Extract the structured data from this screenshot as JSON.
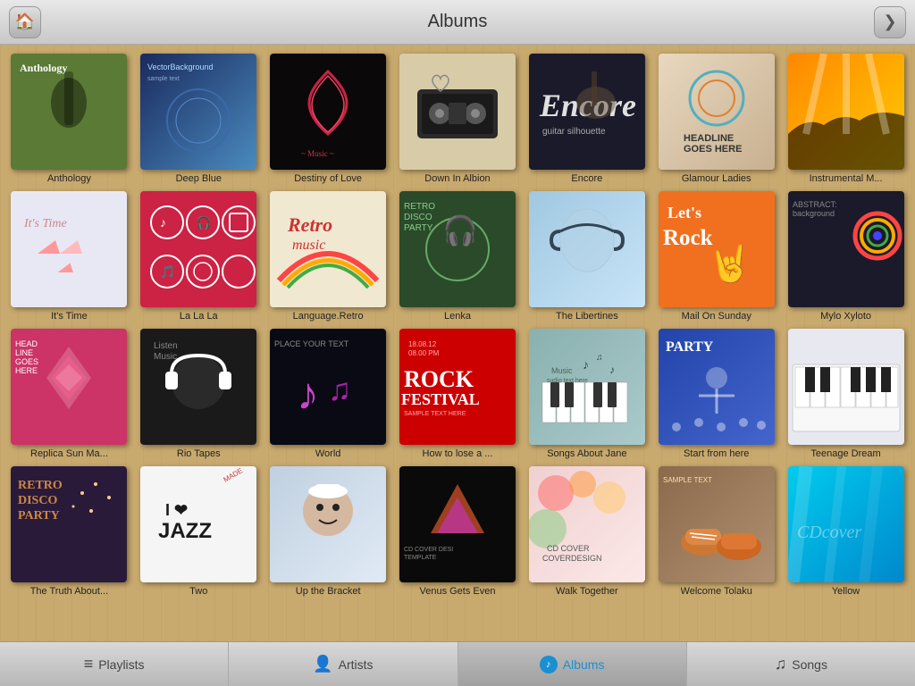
{
  "header": {
    "title": "Albums",
    "home_label": "🏠",
    "back_label": "❯"
  },
  "albums": [
    {
      "id": "anthology",
      "title": "Anthology",
      "cover_class": "cover-anthology"
    },
    {
      "id": "deepblue",
      "title": "Deep Blue",
      "cover_class": "cover-deepblue"
    },
    {
      "id": "destiny",
      "title": "Destiny of Love",
      "cover_class": "cover-destiny"
    },
    {
      "id": "downalbion",
      "title": "Down In Albion",
      "cover_class": "cover-downalbion"
    },
    {
      "id": "encore",
      "title": "Encore",
      "cover_class": "cover-encore"
    },
    {
      "id": "glamour",
      "title": "Glamour Ladies",
      "cover_class": "cover-glamour"
    },
    {
      "id": "instrumental",
      "title": "Instrumental M...",
      "cover_class": "cover-instrumental"
    },
    {
      "id": "itstime",
      "title": "It's Time",
      "cover_class": "cover-itstime"
    },
    {
      "id": "lalala",
      "title": "La La La",
      "cover_class": "cover-lalala"
    },
    {
      "id": "language",
      "title": "Language.Retro",
      "cover_class": "cover-language"
    },
    {
      "id": "lenka",
      "title": "Lenka",
      "cover_class": "cover-lenka"
    },
    {
      "id": "libertines",
      "title": "The Libertines",
      "cover_class": "cover-libertines"
    },
    {
      "id": "mailsunday",
      "title": "Mail On Sunday",
      "cover_class": "cover-mailsunday"
    },
    {
      "id": "mylo",
      "title": "Mylo Xyloto",
      "cover_class": "cover-mylo"
    },
    {
      "id": "replica",
      "title": "Replica Sun Ma...",
      "cover_class": "cover-replica"
    },
    {
      "id": "riotapes",
      "title": "Rio Tapes",
      "cover_class": "cover-riotapes"
    },
    {
      "id": "world",
      "title": "World",
      "cover_class": "cover-world"
    },
    {
      "id": "howtlose",
      "title": "How to lose a ...",
      "cover_class": "cover-howtlose"
    },
    {
      "id": "songs",
      "title": "Songs About Jane",
      "cover_class": "cover-songs"
    },
    {
      "id": "start",
      "title": "Start from here",
      "cover_class": "cover-start"
    },
    {
      "id": "teenage",
      "title": "Teenage Dream",
      "cover_class": "cover-teenage"
    },
    {
      "id": "truth",
      "title": "The Truth About...",
      "cover_class": "cover-truth"
    },
    {
      "id": "two",
      "title": "Two",
      "cover_class": "cover-two"
    },
    {
      "id": "upbracket",
      "title": "Up the Bracket",
      "cover_class": "cover-upbracket"
    },
    {
      "id": "venus",
      "title": "Venus Gets Even",
      "cover_class": "cover-venus"
    },
    {
      "id": "walk",
      "title": "Walk Together",
      "cover_class": "cover-walk"
    },
    {
      "id": "welcome",
      "title": "Welcome Tolaku",
      "cover_class": "cover-welcome"
    },
    {
      "id": "yellow",
      "title": "Yellow",
      "cover_class": "cover-yellow"
    }
  ],
  "tabs": [
    {
      "id": "playlists",
      "label": "Playlists",
      "icon": "≡",
      "active": false
    },
    {
      "id": "artists",
      "label": "Artists",
      "icon": "👤",
      "active": false
    },
    {
      "id": "albums",
      "label": "Albums",
      "icon": "♪",
      "active": true
    },
    {
      "id": "songs",
      "label": "Songs",
      "icon": "♫",
      "active": false
    }
  ]
}
